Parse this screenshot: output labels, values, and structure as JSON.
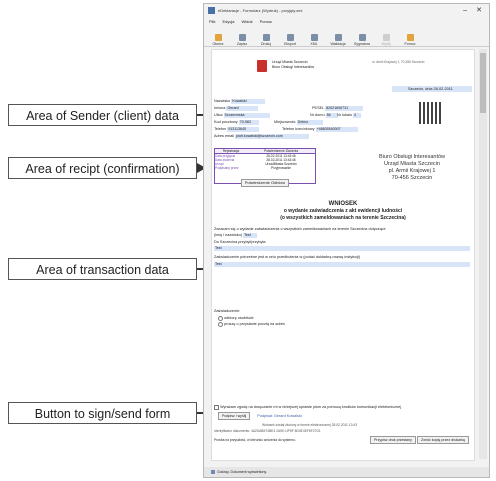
{
  "callouts": {
    "sender": "Area of Sender (client) data",
    "receipt": "Area of recipt (confirmation)",
    "transaction": "Area of transaction data",
    "button": "Button to sign/send form"
  },
  "window": {
    "title": "eDeklaracje - Formularz (Wydruk) - przyjęty.xml",
    "menu": [
      "Plik",
      "Edycja",
      "Widok",
      "Pomoc"
    ],
    "toolbar": [
      "Otwórz",
      "Zapisz",
      "Drukuj",
      "Eksport",
      "XML",
      "Walidacja",
      "Sygnatura",
      "Wyślij",
      "Pomoc"
    ],
    "status": "Gotowy. Dokument wyświetlony."
  },
  "doc": {
    "header_city": "Urząd Miasta Szczecin",
    "header_dept": "Biuro Obsługi Interesantów",
    "header_right": "ul. Armii Krajowej 1, 70-456 Szczecin",
    "date_line": "Szczecin, dnia 28-02-2011",
    "sender": {
      "surname_label": "Nazwisko",
      "surname": "Kowalski",
      "name_label": "Imiona",
      "name": "Gerard",
      "pesel_label": "PESEL",
      "pesel": "82021606731",
      "street_label": "Ulica",
      "street": "Szczecinska",
      "house_label": "Nr domu",
      "house": "86",
      "flat_label": "Nr lokalu",
      "flat": "4",
      "postcode_label": "Kod pocztowy",
      "postcode": "70-983",
      "city_label": "Miejscowość",
      "city": "Debno",
      "phone_label": "Telefon",
      "phone": "913113645",
      "mobile_label": "Telefon komórkowy",
      "mobile": "+48605540007",
      "email_label": "Adres email",
      "email": "piotr.kowalski@szczecin.com"
    },
    "receipt": {
      "h1": "Rejestracja",
      "h2": "Potwierdzenie Złożenia",
      "rows": [
        [
          "Data przyjęcia",
          "28-02-2011 13:43:46"
        ],
        [
          "Data złożenia",
          "28-02-2011 13:43:46"
        ],
        [
          "Urząd",
          "UrzadMiasta Szczecin"
        ],
        [
          "Podpisany przez",
          "Przyjmowanie"
        ]
      ],
      "button": "Potwierdzenie Odbioru"
    },
    "address_block": [
      "Biuro Obsługi Interesantów",
      "Urząd Miasta Szczecin",
      "pl. Armii Krajowej 1",
      "70-456 Szczecin"
    ],
    "heading1": "WNIOSEK",
    "heading2": "o wydanie zaświadczenia z akt ewidencji ludności",
    "heading3": "(o wszystkich zameldowaniach na terenie Szczecina)",
    "tx": {
      "line1": "Zwracam się o wydanie zaświadczenia o wszystkich zameldowaniach na terenie Szczecina dotyczące",
      "line2": "(imię i nazwisko)",
      "value1": "Test",
      "line3": "Do Szczecina przybył/przybyła",
      "value2": "Test",
      "line4": "Zaświadczenie potrzebne jest w celu przedłożenia w (podać dokładną nazwę instytucji)",
      "value3": "Test"
    },
    "options": {
      "label": "Zaświadczenie:",
      "opt1": "odbiorę osobiście",
      "opt2": "proszę o przysłanie pocztą na adres"
    },
    "sign": {
      "checkbox_text": "Wyrażam zgodę na doręczanie mi w niniejszej sprawie pism za pomocą środków komunikacji elektronicznej",
      "sign_button": "Podpisz i wyślij",
      "signed_by": "Podpisał: Gerard Kowalski",
      "line1": "Wniosek został złożony w formie elektronicznej 28.02.2011 13:43",
      "line2": "Identyfikator dokumentu: 4A2SAB574BE4 2A9D UP5F 8D0E4EF6F27D1",
      "line3": "Prośba na przyszłość, w kierunku wrócenia do systemu.",
      "btn1": "Przypisz druk przesłany",
      "btn2": "Zwróć kopię przez drukarkę"
    }
  }
}
